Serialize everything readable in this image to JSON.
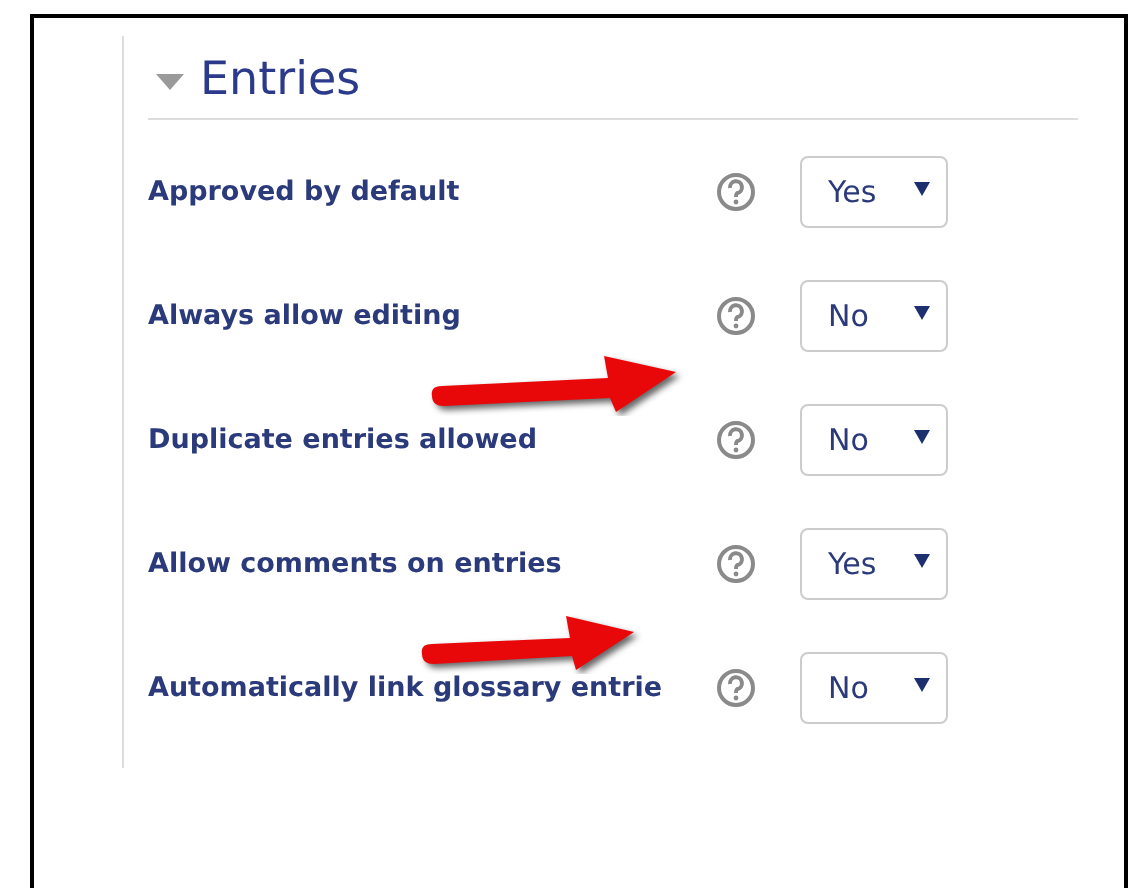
{
  "section": {
    "title": "Entries",
    "expanded": true
  },
  "settings": [
    {
      "label": "Approved by default",
      "value": "Yes"
    },
    {
      "label": "Always allow editing",
      "value": "No"
    },
    {
      "label": "Duplicate entries allowed",
      "value": "No"
    },
    {
      "label": "Allow comments on entries",
      "value": "Yes"
    },
    {
      "label": "Automatically link glossary entrie",
      "value": "No"
    }
  ]
}
